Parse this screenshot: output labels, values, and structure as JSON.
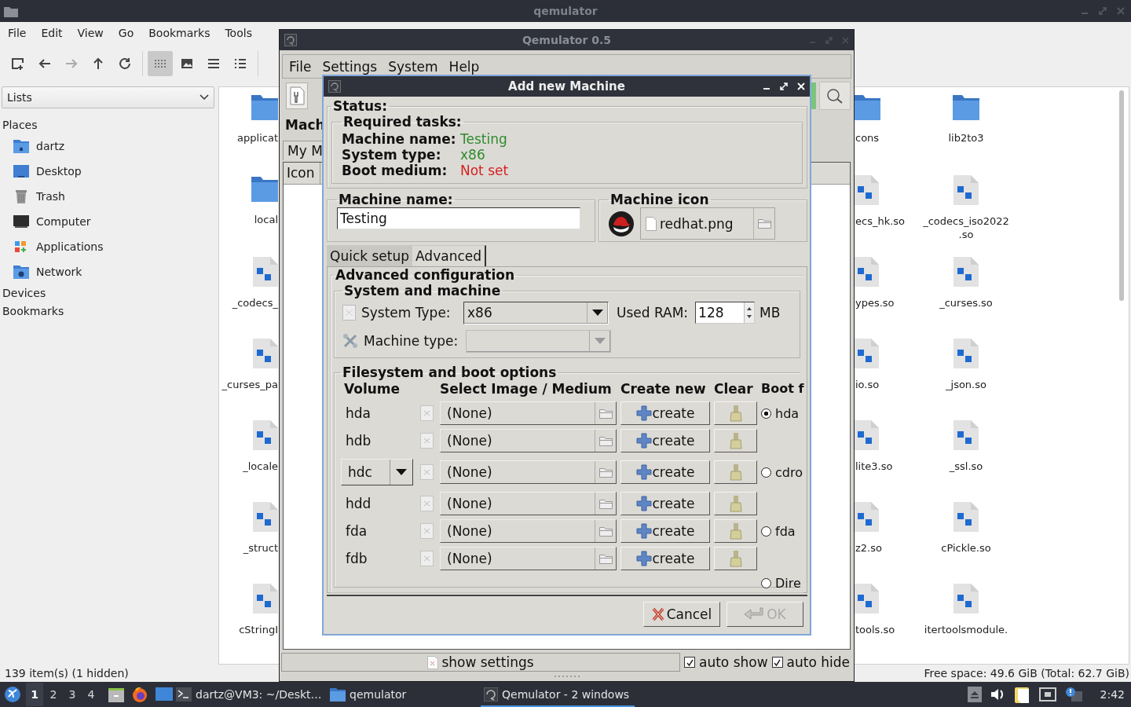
{
  "file_manager": {
    "title": "qemulator",
    "menu": [
      "File",
      "Edit",
      "View",
      "Go",
      "Bookmarks",
      "Tools"
    ],
    "toolbar": [
      {
        "kind": "new",
        "disabled": false,
        "selected": false
      },
      {
        "kind": "back",
        "disabled": false,
        "selected": false
      },
      {
        "kind": "forward",
        "disabled": true,
        "selected": false
      },
      {
        "kind": "up",
        "disabled": false,
        "selected": false
      },
      {
        "kind": "reload",
        "disabled": false,
        "selected": false
      },
      {
        "kind": "icons",
        "disabled": false,
        "selected": true
      },
      {
        "kind": "thumbnails",
        "disabled": false,
        "selected": false
      },
      {
        "kind": "compact",
        "disabled": false,
        "selected": false
      },
      {
        "kind": "details",
        "disabled": false,
        "selected": false
      }
    ],
    "side_view": "Lists",
    "places_heading": "Places",
    "places": [
      {
        "label": "dartz",
        "kind": "home"
      },
      {
        "label": "Desktop",
        "kind": "desktop"
      },
      {
        "label": "Trash",
        "kind": "trash"
      },
      {
        "label": "Computer",
        "kind": "computer"
      },
      {
        "label": "Applications",
        "kind": "applications"
      },
      {
        "label": "Network",
        "kind": "network"
      }
    ],
    "sections": [
      "Devices",
      "Bookmarks"
    ],
    "columns": [
      {
        "items": [
          {
            "name": "applicat",
            "kind": "folder"
          },
          {
            "name": "local",
            "kind": "folder"
          },
          {
            "name": "_codecs_",
            "kind": "file"
          },
          {
            "name": "_curses_pa",
            "kind": "file"
          },
          {
            "name": "_locale",
            "kind": "file"
          },
          {
            "name": "_struct",
            "kind": "file"
          },
          {
            "name": "cStringI",
            "kind": "file"
          }
        ]
      },
      {
        "items": [
          {
            "name": "cons",
            "kind": "folder"
          },
          {
            "name": "ecs_hk.so",
            "kind": "file"
          },
          {
            "name": "ypes.so",
            "kind": "file"
          },
          {
            "name": "io.so",
            "kind": "file"
          },
          {
            "name": "lite3.so",
            "kind": "file"
          },
          {
            "name": "z2.so",
            "kind": "file"
          },
          {
            "name": "tools.so",
            "kind": "file"
          }
        ]
      },
      {
        "items": [
          {
            "name": "lib2to3",
            "kind": "folder"
          },
          {
            "name": "_codecs_iso2022\n.so",
            "kind": "file"
          },
          {
            "name": "_curses.so",
            "kind": "file"
          },
          {
            "name": "_json.so",
            "kind": "file"
          },
          {
            "name": "_ssl.so",
            "kind": "file"
          },
          {
            "name": "cPickle.so",
            "kind": "file"
          },
          {
            "name": "itertoolsmodule.",
            "kind": "file"
          }
        ]
      }
    ],
    "status_left": "139 item(s) (1 hidden)",
    "status_right": "Free space: 49.6 GiB (Total: 62.7 GiB)"
  },
  "taskbar": {
    "workspaces": [
      {
        "label": "1",
        "selected": true
      },
      {
        "label": "2",
        "selected": false
      },
      {
        "label": "3",
        "selected": false
      },
      {
        "label": "4",
        "selected": false
      }
    ],
    "tasks": [
      {
        "label": "dartz@VM3: ~/Deskt…",
        "kind": "terminal",
        "selected": false
      },
      {
        "label": "qemulator",
        "kind": "folder",
        "selected": false
      },
      {
        "label": "Qemulator - 2 windows",
        "kind": "qemu",
        "selected": true
      }
    ],
    "clock": "2:42"
  },
  "qemulator": {
    "title": "Qemulator 0.5",
    "menu": [
      "File",
      "Settings",
      "System",
      "Help"
    ],
    "section": "Mach",
    "tab": "My M",
    "column": "Icon",
    "show_settings": "show settings",
    "options": [
      {
        "label": "auto show",
        "checked": true
      },
      {
        "label": "auto hide",
        "checked": true
      }
    ]
  },
  "dialog": {
    "title": "Add new Machine",
    "status_title": "Status:",
    "tasks_title": "Required tasks:",
    "tasks": [
      {
        "label": "Machine name:",
        "value": "Testing",
        "done": true
      },
      {
        "label": "System type:",
        "value": "x86",
        "done": true
      },
      {
        "label": "Boot medium:",
        "value": "Not set",
        "done": false
      }
    ],
    "name_title": "Machine name:",
    "name_value": "Testing",
    "icon_title": "Machine icon",
    "icon_file": "redhat.png",
    "tabs": [
      {
        "label": "Quick setup",
        "selected": false
      },
      {
        "label": "Advanced",
        "selected": true
      }
    ],
    "advanced_title": "Advanced configuration",
    "system_title": "System and machine",
    "system_type_label": "System Type:",
    "system_type": "x86",
    "ram_label": "Used RAM:",
    "ram": "128",
    "ram_unit": "MB",
    "machine_type_label": "Machine type:",
    "machine_type_disabled": true,
    "fs_title": "Filesystem and boot options",
    "fs_columns": [
      "Volume",
      "Select Image / Medium",
      "Create new",
      "Clear",
      "Boot f"
    ],
    "volumes": [
      {
        "name": "hda",
        "kind": "label",
        "image": "(None)",
        "create": "create",
        "boot": {
          "label": "hda",
          "selected": true
        }
      },
      {
        "name": "hdb",
        "kind": "label",
        "image": "(None)",
        "create": "create"
      },
      {
        "name": "hdc",
        "kind": "combo",
        "image": "(None)",
        "create": "create",
        "boot": {
          "label": "cdro",
          "selected": false
        }
      },
      {
        "name": "hdd",
        "kind": "label",
        "image": "(None)",
        "create": "create"
      },
      {
        "name": "fda",
        "kind": "label",
        "image": "(None)",
        "create": "create",
        "boot": {
          "label": "fda",
          "selected": false
        }
      },
      {
        "name": "fdb",
        "kind": "label",
        "image": "(None)",
        "create": "create"
      }
    ],
    "extra_boot": [
      {
        "label": "Dire",
        "selected": false
      }
    ],
    "buttons": [
      {
        "label": "Cancel",
        "kind": "cancel",
        "disabled": false
      },
      {
        "label": "OK",
        "kind": "ok",
        "disabled": true
      }
    ]
  }
}
